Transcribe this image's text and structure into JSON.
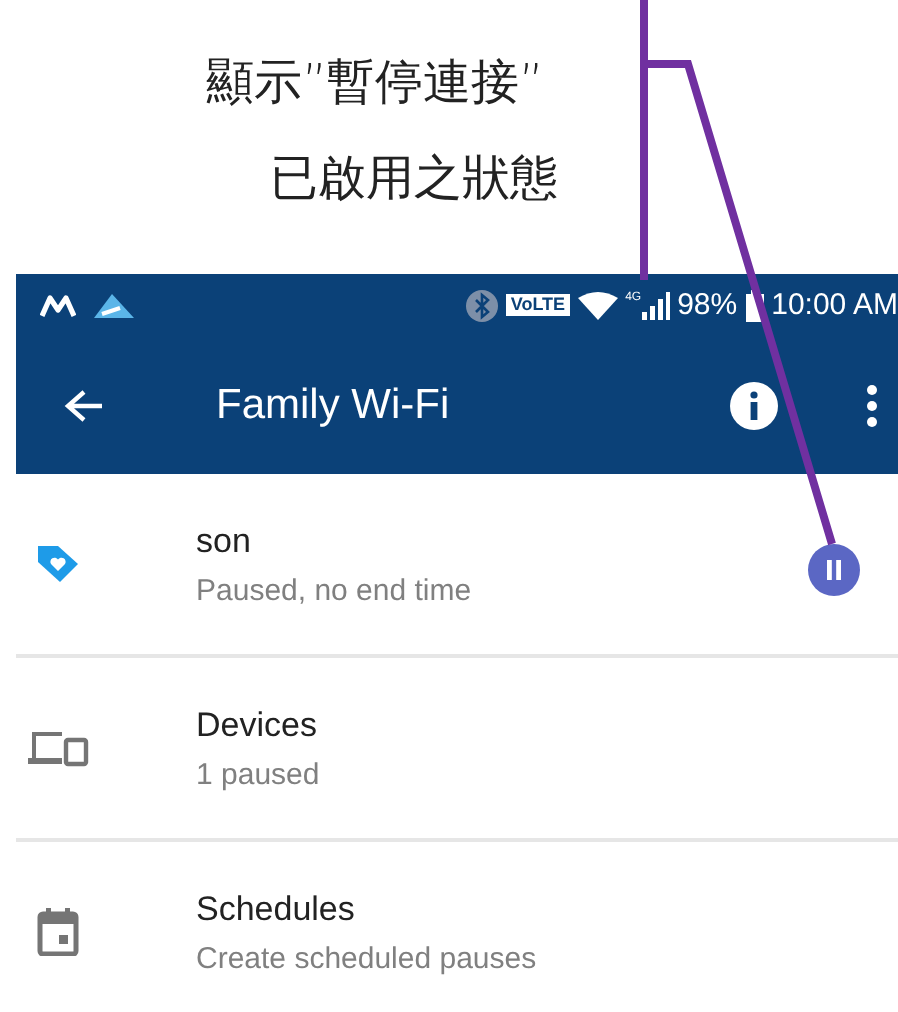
{
  "annotation": {
    "lines": [
      "顯示”暫停連接”",
      "已啟用之狀態"
    ]
  },
  "status_bar": {
    "volte": "VoLTE",
    "network": "4G",
    "battery": "98%",
    "time": "10:00 AM"
  },
  "app_bar": {
    "title": "Family Wi-Fi"
  },
  "items": [
    {
      "kind": "profile",
      "title": "son",
      "subtitle": "Paused, no end time",
      "paused": true
    },
    {
      "kind": "devices",
      "title": "Devices",
      "subtitle": "1 paused",
      "paused": false
    },
    {
      "kind": "schedules",
      "title": "Schedules",
      "subtitle": "Create scheduled pauses",
      "paused": false
    }
  ]
}
